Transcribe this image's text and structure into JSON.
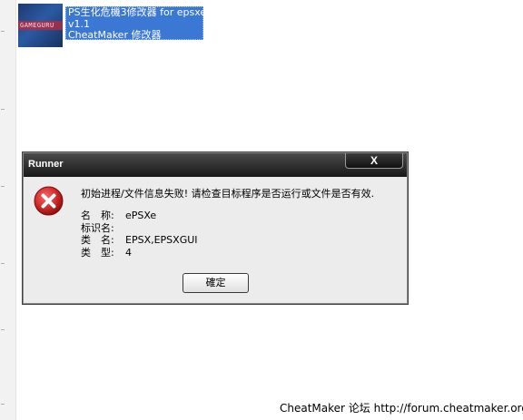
{
  "thumbnail": {
    "watermark": "GAMEGURU"
  },
  "app_item": {
    "title_line1": "PS生化危機3修改器 for epsxe",
    "title_line2": "v1.1",
    "title_line3": "CheatMaker 修改器"
  },
  "dialog": {
    "title": "Runner",
    "close_label": "X",
    "message": "初始进程/文件信息失败! 请检查目标程序是否运行或文件是否有效.",
    "details": [
      {
        "label": "名　称:",
        "value": "ePSXe"
      },
      {
        "label": "标识名:",
        "value": ""
      },
      {
        "label": "类　名:",
        "value": "EPSX,EPSXGUI"
      },
      {
        "label": "类　型:",
        "value": "4"
      }
    ],
    "ok_label": "確定",
    "icon": "error-icon"
  },
  "footer": {
    "text": "CheatMaker 论坛 http://forum.cheatmaker.org/"
  },
  "colors": {
    "selection": "#3a78d4",
    "titlebar": "#1e1e1e",
    "error_red": "#d42b2b"
  }
}
